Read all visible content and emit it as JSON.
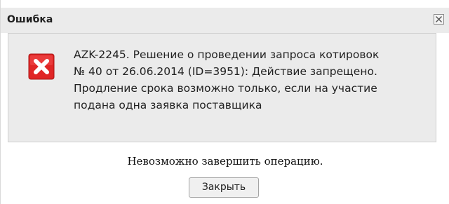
{
  "dialog": {
    "title": "Ошибка",
    "close_icon": "close-x-icon",
    "message": {
      "icon": "error-icon",
      "lines": [
        "AZK-2245. Решение о проведении запроса котировок",
        "№ 40 от 26.06.2014 (ID=3951): Действие запрещено.",
        "Продление срока возможно только, если на участие",
        "подана одна заявка поставщика"
      ]
    },
    "status_text": "Невозможно завершить операцию.",
    "close_button_label": "Закрыть",
    "colors": {
      "titlebar_bg": "#ebebeb",
      "panel_bg": "#ebebeb",
      "error_red": "#e02626",
      "button_bg": "#f0f0f0"
    }
  }
}
